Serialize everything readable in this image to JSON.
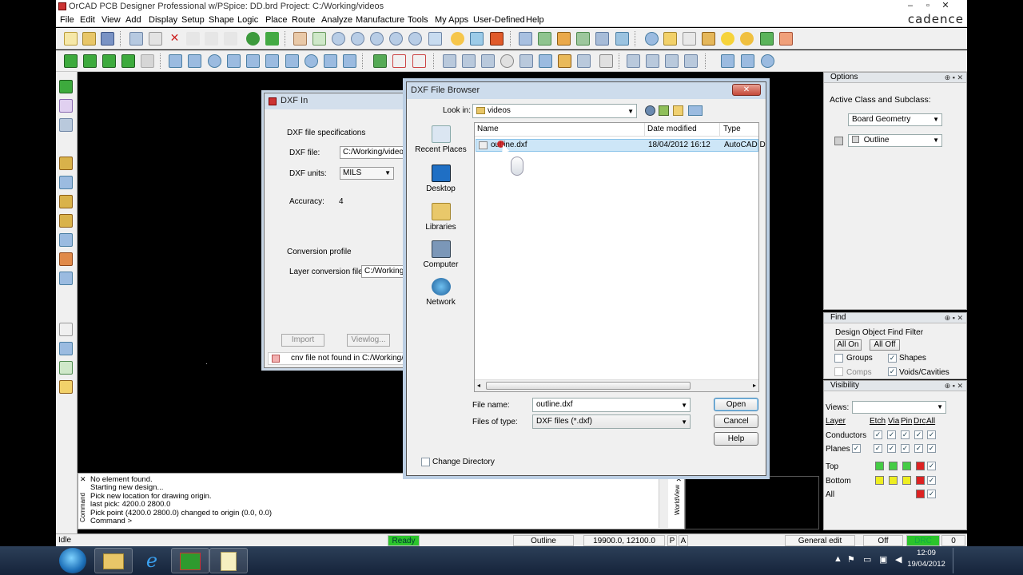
{
  "window": {
    "title": "OrCAD PCB Designer Professional w/PSpice: DD.brd  Project: C:/Working/videos",
    "min": "–",
    "max": "▫",
    "close": "✕"
  },
  "brand": "cadence",
  "menu": [
    "File",
    "Edit",
    "View",
    "Add",
    "Display",
    "Setup",
    "Shape",
    "Logic",
    "Place",
    "Route",
    "Analyze",
    "Manufacture",
    "Tools",
    "My Apps",
    "User-Defined",
    "Help"
  ],
  "dxf_in": {
    "title": "DXF In",
    "spec_group": "DXF file specifications",
    "file_label": "DXF file:",
    "file_value": "C:/Working/videos/o",
    "units_label": "DXF units:",
    "units_value": "MILS",
    "accuracy_label": "Accuracy:",
    "accuracy_value": "4",
    "profile_group": "Conversion profile",
    "layer_label": "Layer conversion file:",
    "layer_value": "C:/Working/vi",
    "import": "Import",
    "viewlog": "Viewlog...",
    "status": "cnv file not found in C:/Working/vide"
  },
  "browser": {
    "title": "DXF File Browser",
    "close": "✕",
    "look_in_label": "Look in:",
    "look_in_value": "videos",
    "places": [
      "Recent Places",
      "Desktop",
      "Libraries",
      "Computer",
      "Network"
    ],
    "columns": [
      "Name",
      "Date modified",
      "Type"
    ],
    "file": {
      "name": "outline.dxf",
      "date": "18/04/2012 16:12",
      "type": "AutoCAD D"
    },
    "filename_label": "File name:",
    "filename_value": "outline.dxf",
    "filetype_label": "Files of type:",
    "filetype_value": "DXF files (*.dxf)",
    "open": "Open",
    "cancel": "Cancel",
    "help": "Help",
    "change_dir": "Change Directory"
  },
  "options_panel": {
    "title": "Options",
    "active_label": "Active Class and Subclass:",
    "class_value": "Board Geometry",
    "subclass_value": "Outline",
    "color_swatch": "#cfcfcf"
  },
  "find_panel": {
    "title": "Find",
    "filter_label": "Design Object Find Filter",
    "all_on": "All On",
    "all_off": "All Off",
    "groups": "Groups",
    "shapes": "Shapes",
    "comps": "Comps",
    "voids": "Voids/Cavities"
  },
  "visibility_panel": {
    "title": "Visibility",
    "views_label": "Views:",
    "layer_label": "Layer",
    "cols": [
      "Etch",
      "Via",
      "Pin",
      "Drc",
      "All"
    ],
    "conductors": "Conductors",
    "planes": "Planes",
    "top": "Top",
    "bottom": "Bottom",
    "all": "All",
    "colors": {
      "green": "#44cc44",
      "yellow": "#eeee22",
      "red": "#dd2222"
    }
  },
  "command": {
    "tab_label": "Command",
    "world_label": "WorldView",
    "lines": [
      "No element found.",
      "Starting new design...",
      "Pick new location for drawing origin.",
      "last pick:  4200.0  2800.0",
      "Pick point (4200.0 2800.0) changed to origin (0.0, 0.0)",
      "Command >"
    ]
  },
  "status": {
    "idle": "Idle",
    "ready": "Ready",
    "subclass": "Outline",
    "coords": "19900.0, 12100.0",
    "p": "P",
    "a": "A",
    "mode": "General edit",
    "off": "Off",
    "drc": "DRC",
    "count": "0"
  },
  "clock": {
    "time": "12:09",
    "date": "19/04/2012"
  }
}
